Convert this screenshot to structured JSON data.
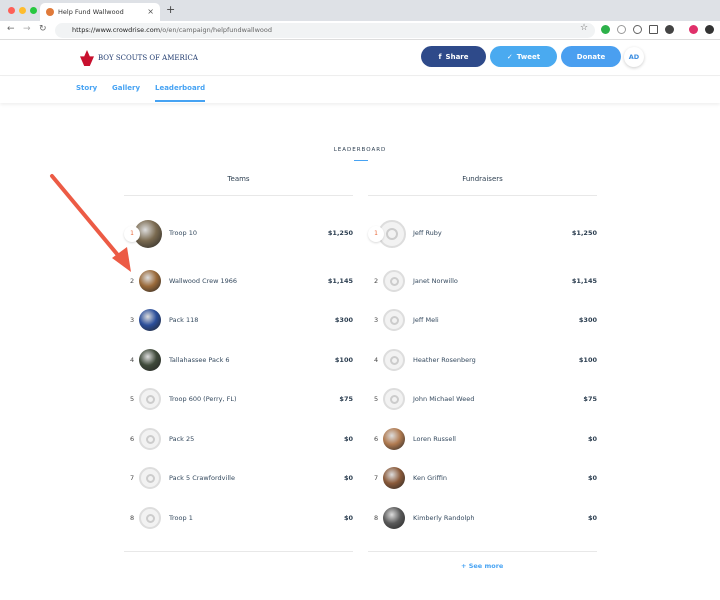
{
  "browser": {
    "tab_title": "Help Fund Wallwood",
    "url_host": "https://www.crowdrise.com",
    "url_path": "/o/en/campaign/helpfundwallwood"
  },
  "header": {
    "logo_text": "BOY SCOUTS OF AMERICA",
    "share": "Share",
    "tweet": "Tweet",
    "donate": "Donate",
    "avatar": "AD"
  },
  "tabs": [
    "Story",
    "Gallery",
    "Leaderboard"
  ],
  "leaderboard": {
    "title": "LEADERBOARD",
    "see_more": "+ See more",
    "teams": {
      "header": "Teams",
      "rows": [
        {
          "rank": "1",
          "name": "Troop 10",
          "amount": "$1,250",
          "avatar": "#7a6a50"
        },
        {
          "rank": "2",
          "name": "Wallwood Crew 1966",
          "amount": "$1,145",
          "avatar": "#9a6a3a"
        },
        {
          "rank": "3",
          "name": "Pack 118",
          "amount": "$300",
          "avatar": "#2b4e9a"
        },
        {
          "rank": "4",
          "name": "Tallahassee Pack 6",
          "amount": "$100",
          "avatar": "#3f4a3a"
        },
        {
          "rank": "5",
          "name": "Troop 600 (Perry, FL)",
          "amount": "$75",
          "avatar": ""
        },
        {
          "rank": "6",
          "name": "Pack 25",
          "amount": "$0",
          "avatar": ""
        },
        {
          "rank": "7",
          "name": "Pack 5 Crawfordville",
          "amount": "$0",
          "avatar": ""
        },
        {
          "rank": "8",
          "name": "Troop 1",
          "amount": "$0",
          "avatar": ""
        }
      ]
    },
    "fundraisers": {
      "header": "Fundraisers",
      "rows": [
        {
          "rank": "1",
          "name": "Jeff Ruby",
          "amount": "$1,250",
          "avatar": ""
        },
        {
          "rank": "2",
          "name": "Janet Norwillo",
          "amount": "$1,145",
          "avatar": ""
        },
        {
          "rank": "3",
          "name": "Jeff Meli",
          "amount": "$300",
          "avatar": ""
        },
        {
          "rank": "4",
          "name": "Heather Rosenberg",
          "amount": "$100",
          "avatar": ""
        },
        {
          "rank": "5",
          "name": "John Michael Weed",
          "amount": "$75",
          "avatar": ""
        },
        {
          "rank": "6",
          "name": "Loren Russell",
          "amount": "$0",
          "avatar": "#b07a50"
        },
        {
          "rank": "7",
          "name": "Ken Griffin",
          "amount": "$0",
          "avatar": "#8a5a3a"
        },
        {
          "rank": "8",
          "name": "Kimberly Randolph",
          "amount": "$0",
          "avatar": "#5a5a5a"
        }
      ]
    }
  }
}
